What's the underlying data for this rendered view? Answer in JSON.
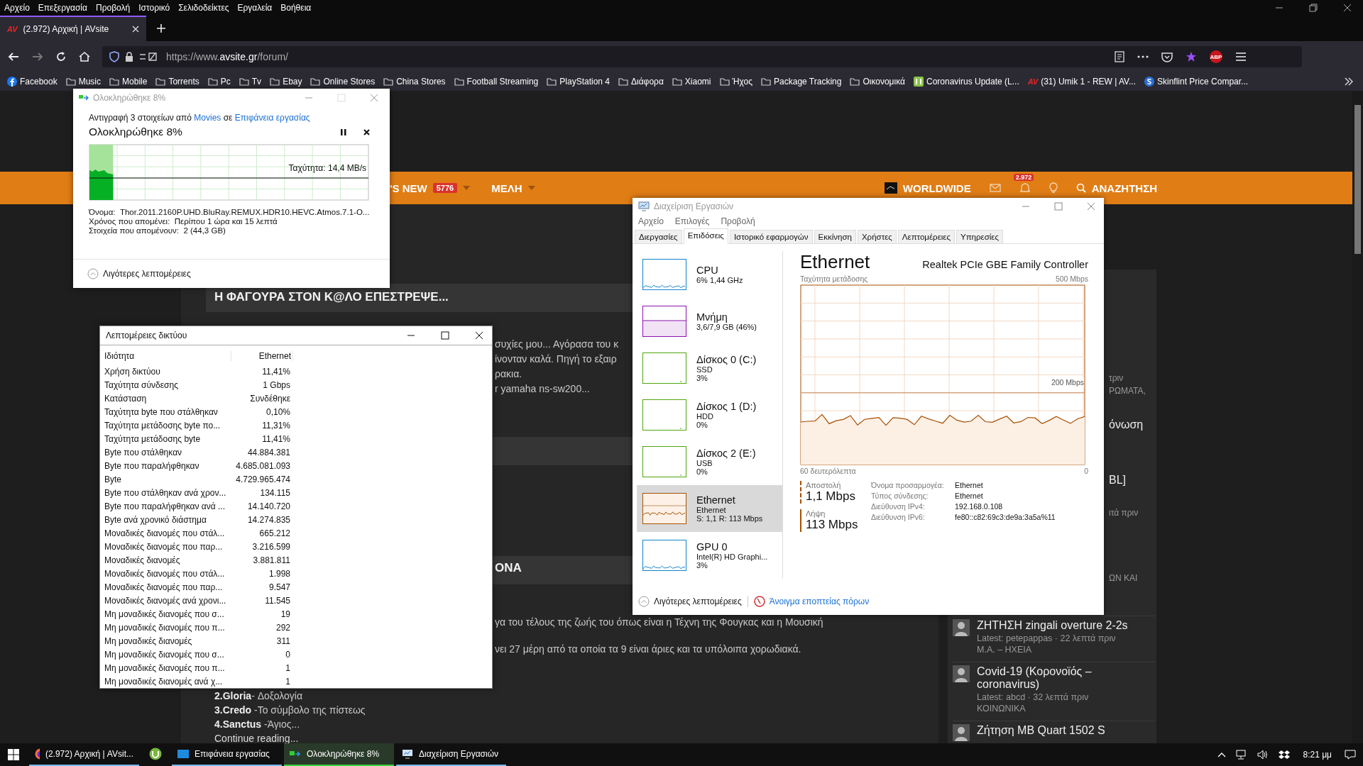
{
  "browser": {
    "menu": [
      "Αρχείο",
      "Επεξεργασία",
      "Προβολή",
      "Ιστορικό",
      "Σελιδοδείκτες",
      "Εργαλεία",
      "Βοήθεια"
    ],
    "tab": {
      "logo": "AV",
      "title": "(2.972) Αρχική | AVsite"
    },
    "url": {
      "scheme": "https://www.",
      "domain": "avsite.gr",
      "path": "/forum/"
    },
    "adblock_badge": "ABP",
    "bookmarks": [
      {
        "label": "Facebook",
        "kind": "facebook"
      },
      {
        "label": "Music",
        "kind": "folder"
      },
      {
        "label": "Mobile",
        "kind": "folder"
      },
      {
        "label": "Torrents",
        "kind": "folder"
      },
      {
        "label": "Pc",
        "kind": "folder"
      },
      {
        "label": "Tv",
        "kind": "folder"
      },
      {
        "label": "Ebay",
        "kind": "folder"
      },
      {
        "label": "Online Stores",
        "kind": "folder"
      },
      {
        "label": "China Stores",
        "kind": "folder"
      },
      {
        "label": "Football Streaming",
        "kind": "folder"
      },
      {
        "label": "PlayStation 4",
        "kind": "folder"
      },
      {
        "label": "Διάφορα",
        "kind": "folder"
      },
      {
        "label": "Xiaomi",
        "kind": "folder"
      },
      {
        "label": "Ήχος",
        "kind": "folder"
      },
      {
        "label": "Package Tracking",
        "kind": "folder"
      },
      {
        "label": "Οικονομικά",
        "kind": "folder"
      },
      {
        "label": "Coronavirus Update (L...",
        "kind": "tracker"
      },
      {
        "label": "(31) Umik 1 - REW | AV...",
        "kind": "logo",
        "logo": "AV"
      },
      {
        "label": "Skinflint Price Compar...",
        "kind": "skinflint"
      }
    ]
  },
  "forum": {
    "nav": [
      {
        "label": "'S NEW",
        "badge": "5776",
        "dropdown": true
      },
      {
        "label": "ΜΕΛΗ",
        "dropdown": true
      }
    ],
    "region": "WORLDWIDE",
    "alerts": "2.972",
    "search": "ΑΝΑΖΗΤΗΣΗ",
    "thread_title": "Η ΦΑΓΟΥΡΑ ΣΤΟΝ Κ@ΛΟ ΕΠΕΣΤΡΕΨΕ...",
    "post_lines": [
      "συχίες μου... Αγόρασα του κ",
      "ίνονταν καλά. Πηγή το εξαιρ",
      "ρακια.",
      "r yamaha ns-sw200..."
    ],
    "section_title": "ΟΝΑ",
    "body_lines": [
      "γα του τέλους της ζωής του όπως είναι η Τέχνη της Φουγκας και η Μουσική",
      "νει 27 μέρη από τα οποία τα 9 είναι άριες και τα υπόλοιπα χορωδιακά."
    ],
    "list_lines": [
      "**2.Gloria**- Δοξολογία",
      "**3.Credo** -Το σύμβολο της πίστεως",
      "**4.Sanctus** -Άγιος..."
    ],
    "continue": "Continue reading...",
    "sidebar_fragments": [
      {
        "text": "τριν",
        "kind": "meta"
      },
      {
        "text": "ΡΩΜΑΤΑ,",
        "kind": "meta"
      },
      {
        "text": "όνωση",
        "kind": "title"
      },
      {
        "text": "BL]",
        "kind": "title"
      },
      {
        "text": "ιτά πριν",
        "kind": "meta"
      },
      {
        "text": "ΩΝ ΚΑΙ",
        "kind": "meta"
      }
    ],
    "sidebar_threads": [
      {
        "title": "ΖΗΤΗΣΗ zingali overture 2-2s",
        "meta": "Latest: petepappas · 22 λεπτά πριν",
        "forum": "Μ.Α. – ΗΧΕΙΑ"
      },
      {
        "title": "Covid-19 (Κορονοϊός – coronavirus)",
        "meta": "Latest: abcd · 32 λεπτά πριν",
        "forum": "ΚΟΙΝΩΝΙΚΑ"
      },
      {
        "title": "Ζήτηση MB Quart 1502 S"
      }
    ]
  },
  "copy_dialog": {
    "title": "Ολοκληρώθηκε 8%",
    "description": {
      "prefix": "Αντιγραφή 3 στοιχείων από",
      "source": "Movies",
      "middle": "σε",
      "destination": "Επιφάνεια εργασίας"
    },
    "status": "Ολοκληρώθηκε 8%",
    "level": 0.085,
    "speed": "Ταχύτητα: 14,4 MB/s",
    "details": [
      {
        "label": "Όνομα:",
        "value": "Thor.2011.2160P.UHD.BluRay.REMUX.HDR10.HEVC.Atmos.7.1-O..."
      },
      {
        "label": "Χρόνος που απομένει:",
        "value": "Περίπου 1 ώρα και 15 λεπτά"
      },
      {
        "label": "Στοιχεία που απομένουν:",
        "value": "2 (44,3 GB)"
      }
    ],
    "toggle": "Λιγότερες λεπτομέρειες"
  },
  "network_details": {
    "title": "Λεπτομέρειες δικτύου",
    "columns": [
      "Ιδιότητα",
      "Ethernet"
    ],
    "rows": [
      {
        "property": "Χρήση δικτύου",
        "value": "11,41%"
      },
      {
        "property": "Ταχύτητα σύνδεσης",
        "value": "1 Gbps"
      },
      {
        "property": "Κατάσταση",
        "value": "Συνδέθηκε"
      },
      {
        "property": "Ταχύτητα byte που στάλθηκαν",
        "value": "0,10%"
      },
      {
        "property": "Ταχύτητα μετάδοσης byte πο...",
        "value": "11,31%"
      },
      {
        "property": "Ταχύτητα μετάδοσης byte",
        "value": "11,41%"
      },
      {
        "property": "Byte που στάλθηκαν",
        "value": "44.884.381"
      },
      {
        "property": "Byte που παραλήφθηκαν",
        "value": "4.685.081.093"
      },
      {
        "property": "Byte",
        "value": "4.729.965.474"
      },
      {
        "property": "Byte που στάλθηκαν ανά χρον...",
        "value": "134.115"
      },
      {
        "property": "Byte που παραλήφθηκαν ανά ...",
        "value": "14.140.720"
      },
      {
        "property": "Byte ανά χρονικό διάστημα",
        "value": "14.274.835"
      },
      {
        "property": "Μοναδικές διανομές που στάλ...",
        "value": "665.212"
      },
      {
        "property": "Μοναδικές διανομές που παρ...",
        "value": "3.216.599"
      },
      {
        "property": "Μοναδικές διανομές",
        "value": "3.881.811"
      },
      {
        "property": "Μοναδικές διανομές που στάλ...",
        "value": "1.998"
      },
      {
        "property": "Μοναδικές διανομές που παρ...",
        "value": "9.547"
      },
      {
        "property": "Μοναδικές διανομές ανά χρονι...",
        "value": "11.545"
      },
      {
        "property": "Μη μοναδικές διανομές που σ...",
        "value": "19"
      },
      {
        "property": "Μη μοναδικές διανομές που π...",
        "value": "292"
      },
      {
        "property": "Μη μοναδικές διανομές",
        "value": "311"
      },
      {
        "property": "Μη μοναδικές διανομές που σ...",
        "value": "0"
      },
      {
        "property": "Μη μοναδικές διανομές που π...",
        "value": "1"
      },
      {
        "property": "Μη μοναδικές διανομές ανά χ...",
        "value": "1"
      }
    ]
  },
  "task_manager": {
    "title": "Διαχείριση Εργασιών",
    "menu": [
      "Αρχείο",
      "Επιλογές",
      "Προβολή"
    ],
    "tabs": [
      {
        "label": "Διεργασίες",
        "selected": false
      },
      {
        "label": "Επιδόσεις",
        "selected": true
      },
      {
        "label": "Ιστορικό εφαρμογών",
        "selected": false
      },
      {
        "label": "Εκκίνηση",
        "selected": false
      },
      {
        "label": "Χρήστες",
        "selected": false
      },
      {
        "label": "Λεπτομέρειες",
        "selected": false
      },
      {
        "label": "Υπηρεσίες",
        "selected": false
      }
    ],
    "resources": [
      {
        "name": "CPU",
        "lines": [
          "6% 1,44 GHz"
        ],
        "kind": "cpu",
        "color": "#1183c9",
        "selected": false
      },
      {
        "name": "Μνήμη",
        "lines": [
          "3,6/7,9 GB (46%)"
        ],
        "kind": "memory",
        "color": "#8b12ae",
        "selected": false
      },
      {
        "name": "Δίσκος 0 (C:)",
        "lines": [
          "SSD",
          "3%"
        ],
        "kind": "disk",
        "color": "#4da60c",
        "selected": false
      },
      {
        "name": "Δίσκος 1 (D:)",
        "lines": [
          "HDD",
          "0%"
        ],
        "kind": "disk",
        "color": "#4da60c",
        "selected": false
      },
      {
        "name": "Δίσκος 2 (E:)",
        "lines": [
          "USB",
          "0%"
        ],
        "kind": "disk",
        "color": "#4da60c",
        "selected": false
      },
      {
        "name": "Ethernet",
        "lines": [
          "Ethernet",
          "S: 1,1 R: 113 Mbps"
        ],
        "kind": "network",
        "color": "#a74f01",
        "selected": true
      },
      {
        "name": "GPU 0",
        "lines": [
          "Intel(R) HD Graphi...",
          "3%"
        ],
        "kind": "cpu",
        "color": "#1183c9",
        "selected": false
      }
    ],
    "detail": {
      "title": "Ethernet",
      "adapter": "Realtek PCIe GBE Family Controller",
      "graph_label": "Ταχύτητα μετάδοσης",
      "graph_max": "500 Mbps",
      "graph_mid": "200 Mbps",
      "time_span": "60 δευτερόλεπτα",
      "time_end": "0",
      "send": {
        "label": "Αποστολή",
        "value": "1,1 Mbps"
      },
      "receive": {
        "label": "Λήψη",
        "value": "113 Mbps"
      },
      "properties": [
        {
          "label": "Όνομα προσαρμογέα:",
          "value": "Ethernet"
        },
        {
          "label": "Τύπος σύνδεσης:",
          "value": "Ethernet"
        },
        {
          "label": "Διεύθυνση IPv4:",
          "value": "192.168.0.108"
        },
        {
          "label": "Διεύθυνση IPv6:",
          "value": "fe80::c82:69c3:de9a:3a5a%11"
        }
      ]
    },
    "footer": {
      "toggle": "Λιγότερες λεπτομέρειες",
      "link": "Άνοιγμα εποπτείας πόρων"
    }
  },
  "taskbar": {
    "items": [
      {
        "label": "(2.972) Αρχική | AVsit...",
        "kind": "browser",
        "selected": false
      },
      {
        "kind": "torrent",
        "selected": false
      },
      {
        "label": "Επιφάνεια εργασίας",
        "kind": "folder",
        "selected": false
      },
      {
        "label": "Ολοκληρώθηκε 8%",
        "kind": "copy",
        "selected": true
      },
      {
        "label": "Διαχείριση Εργασιών",
        "kind": "monitor",
        "selected": false
      }
    ],
    "clock": "8:21 μμ"
  }
}
